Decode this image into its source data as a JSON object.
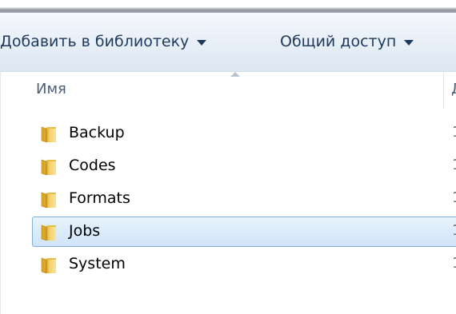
{
  "toolbar": {
    "add_to_library_label": "Добавить в библиотеку",
    "share_label": "Общий доступ"
  },
  "columns": {
    "name_label": "Имя",
    "next_column_partial": "Д"
  },
  "files": [
    {
      "name": "Backup",
      "meta": "1",
      "selected": false
    },
    {
      "name": "Codes",
      "meta": "1",
      "selected": false
    },
    {
      "name": "Formats",
      "meta": "1",
      "selected": false
    },
    {
      "name": "Jobs",
      "meta": "1",
      "selected": true
    },
    {
      "name": "System",
      "meta": "1",
      "selected": false
    }
  ],
  "colors": {
    "toolbar_text": "#1e395b",
    "selection_border": "#84acdd",
    "selection_fill": "#cfe4f9",
    "folder_yellow": "#f2c94c"
  },
  "icons": {
    "folder": "folder-icon",
    "dropdown": "chevron-down-icon",
    "sort": "sort-up-arrow-icon"
  }
}
